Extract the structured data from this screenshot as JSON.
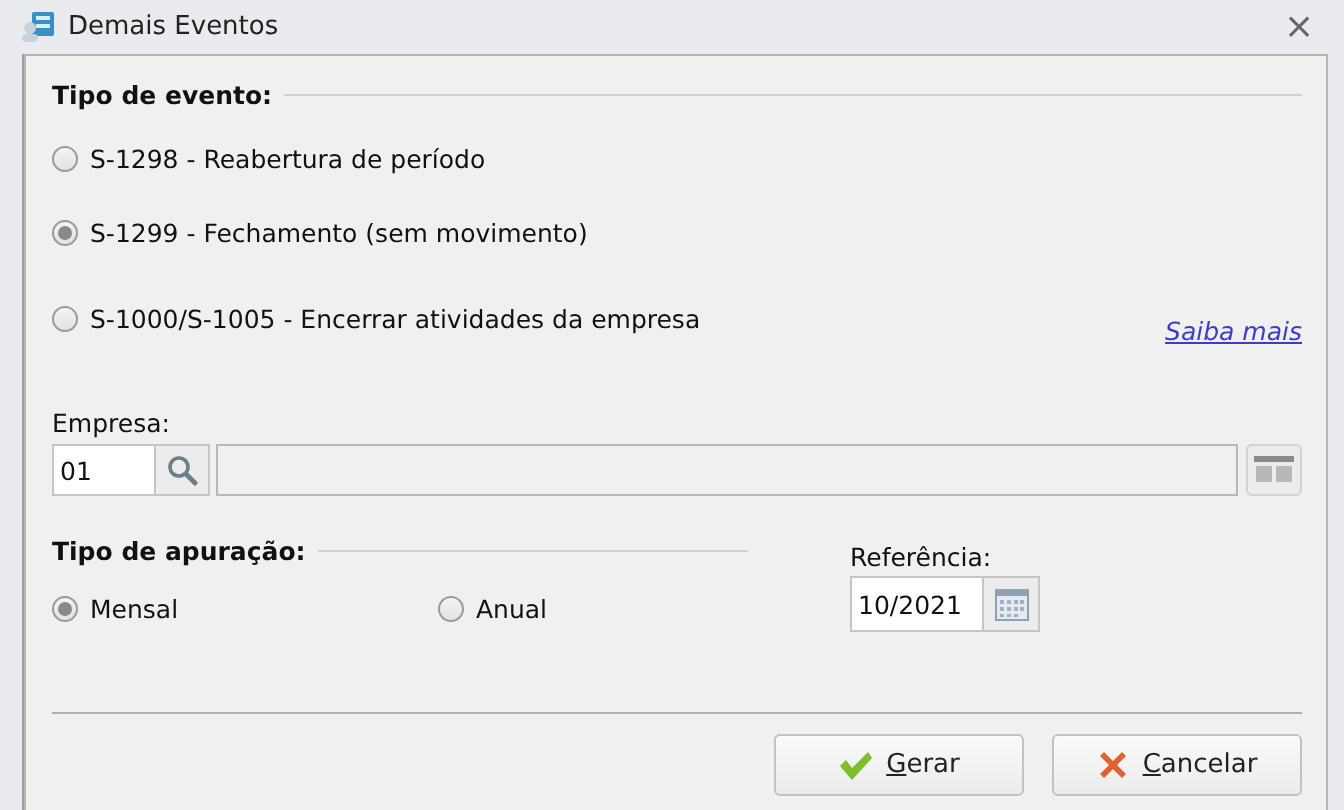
{
  "window": {
    "title": "Demais Eventos",
    "close": "×"
  },
  "event_type": {
    "label": "Tipo de evento:",
    "options": [
      {
        "label": "S-1298 - Reabertura de período",
        "selected": false
      },
      {
        "label": "S-1299 - Fechamento (sem movimento)",
        "selected": true
      },
      {
        "label": "S-1000/S-1005 - Encerrar atividades da empresa",
        "selected": false
      }
    ],
    "link": "Saiba mais"
  },
  "company": {
    "label": "Empresa:",
    "code": "01"
  },
  "period_type": {
    "label": "Tipo de apuração:",
    "options": [
      {
        "label": "Mensal",
        "selected": true
      },
      {
        "label": "Anual",
        "selected": false
      }
    ]
  },
  "reference": {
    "label": "Referência:",
    "value": "10/2021"
  },
  "buttons": [
    {
      "label": "Gerar",
      "kind": "ok"
    },
    {
      "label": "Cancelar",
      "kind": "cancel"
    }
  ]
}
